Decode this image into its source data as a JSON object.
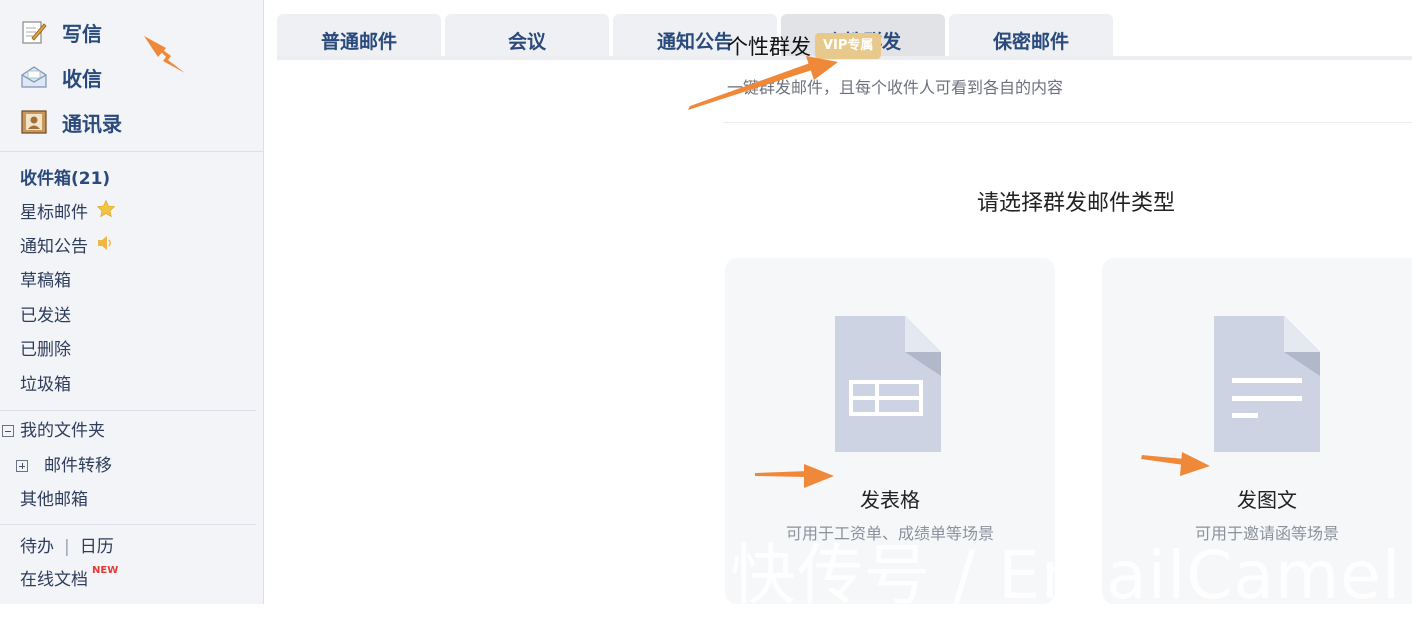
{
  "sidebar": {
    "actions": [
      {
        "label": "写信",
        "icon": "compose-icon"
      },
      {
        "label": "收信",
        "icon": "receive-mail-icon"
      },
      {
        "label": "通讯录",
        "icon": "contacts-icon"
      }
    ],
    "folders": {
      "inbox": "收件箱(21)",
      "starred": "星标邮件",
      "notices": "通知公告",
      "drafts": "草稿箱",
      "sent": "已发送",
      "deleted": "已删除",
      "spam": "垃圾箱"
    },
    "my_folders": "我的文件夹",
    "mail_forward": "邮件转移",
    "other_mailboxes": "其他邮箱",
    "todo": "待办",
    "calendar": "日历",
    "online_docs": "在线文档",
    "new_badge": "NEW"
  },
  "tabs": [
    {
      "label": "普通邮件"
    },
    {
      "label": "会议"
    },
    {
      "label": "通知公告"
    },
    {
      "label": "个性群发"
    },
    {
      "label": "保密邮件"
    }
  ],
  "mass_mail": {
    "title": "个性群发",
    "vip_badge": "VIP专属",
    "subtitle": "一键群发邮件，且每个收件人可看到各自的内容",
    "choose_title": "请选择群发邮件类型",
    "cards": [
      {
        "label": "发表格",
        "desc": "可用于工资单、成绩单等场景"
      },
      {
        "label": "发图文",
        "desc": "可用于邀请函等场景"
      }
    ]
  },
  "watermark": "快传号 / EmailCamel",
  "colors": {
    "accent_blue": "#2a4a7c",
    "arrow_orange": "#f0883a",
    "vip_gold": "#e7c98c",
    "doc_icon": "#cdd3e2"
  }
}
